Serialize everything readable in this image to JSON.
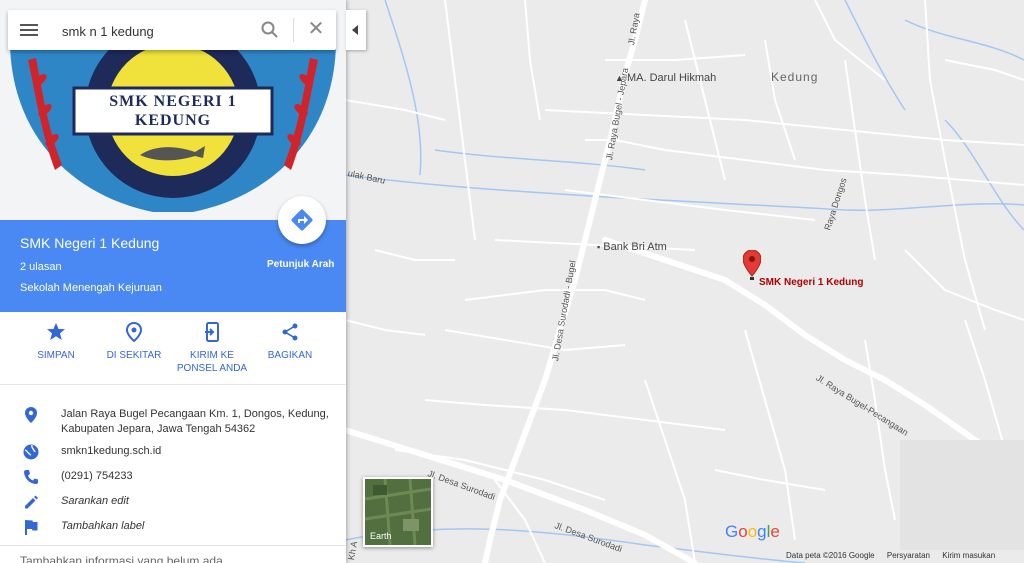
{
  "search": {
    "value": "smk n 1 kedung"
  },
  "hero": {
    "logo_line1": "SMK NEGERI 1",
    "logo_line2": "KEDUNG"
  },
  "place": {
    "title": "SMK Negeri 1 Kedung",
    "reviews": "2 ulasan",
    "category": "Sekolah Menengah Kejuruan",
    "directions_label": "Petunjuk Arah"
  },
  "actions": [
    {
      "label": "SIMPAN",
      "icon": "star-icon"
    },
    {
      "label": "DI SEKITAR",
      "icon": "nearby-pin-icon"
    },
    {
      "label": "KIRIM KE PONSEL ANDA",
      "icon": "send-to-phone-icon"
    },
    {
      "label": "BAGIKAN",
      "icon": "share-icon"
    }
  ],
  "info": {
    "address": "Jalan Raya Bugel Pecangaan Km. 1, Dongos, Kedung, Kabupaten Jepara, Jawa Tengah 54362",
    "website": "smkn1kedung.sch.id",
    "phone": "(0291) 754233",
    "suggest_edit": "Sarankan edit",
    "add_label": "Tambahkan label",
    "add_missing_info": "Tambahkan informasi yang belum ada"
  },
  "map": {
    "labels": {
      "kedung": "Kedung",
      "ma_darul_hikmah": "MA. Darul Hikmah",
      "bank_bri": "Bank Bri Atm",
      "pin": "SMK Negeri 1 Kedung",
      "jl_raya_jepara": "Jl. Raya Bugel - Jepara",
      "jl_raya_jepara_top": "Jl. Raya",
      "jl_desa_surodadi_bugel": "Jl. Desa Surodadi - Bugel",
      "jl_raya_bugel_pecangaan": "Jl. Raya Bugel-Pecangaan",
      "jl_desa_surodadi": "Jl. Desa Surodadi",
      "jl_desa_surodadi_2": "Jl. Desa Surodadi",
      "raya_dongos": "Raya Dongos",
      "ulak_baru": "ulak Baru",
      "kh_a": "Kh A"
    },
    "earth_label": "Earth",
    "google_logo": "Google",
    "footer": {
      "data": "Data peta ©2016 Google",
      "terms": "Persyaratan",
      "feedback": "Kirim masukan"
    },
    "pin_color": "#e53935",
    "water_color": "#a3c7f3"
  },
  "colors": {
    "accent": "#4a89f3",
    "action_blue": "#3367d6"
  }
}
